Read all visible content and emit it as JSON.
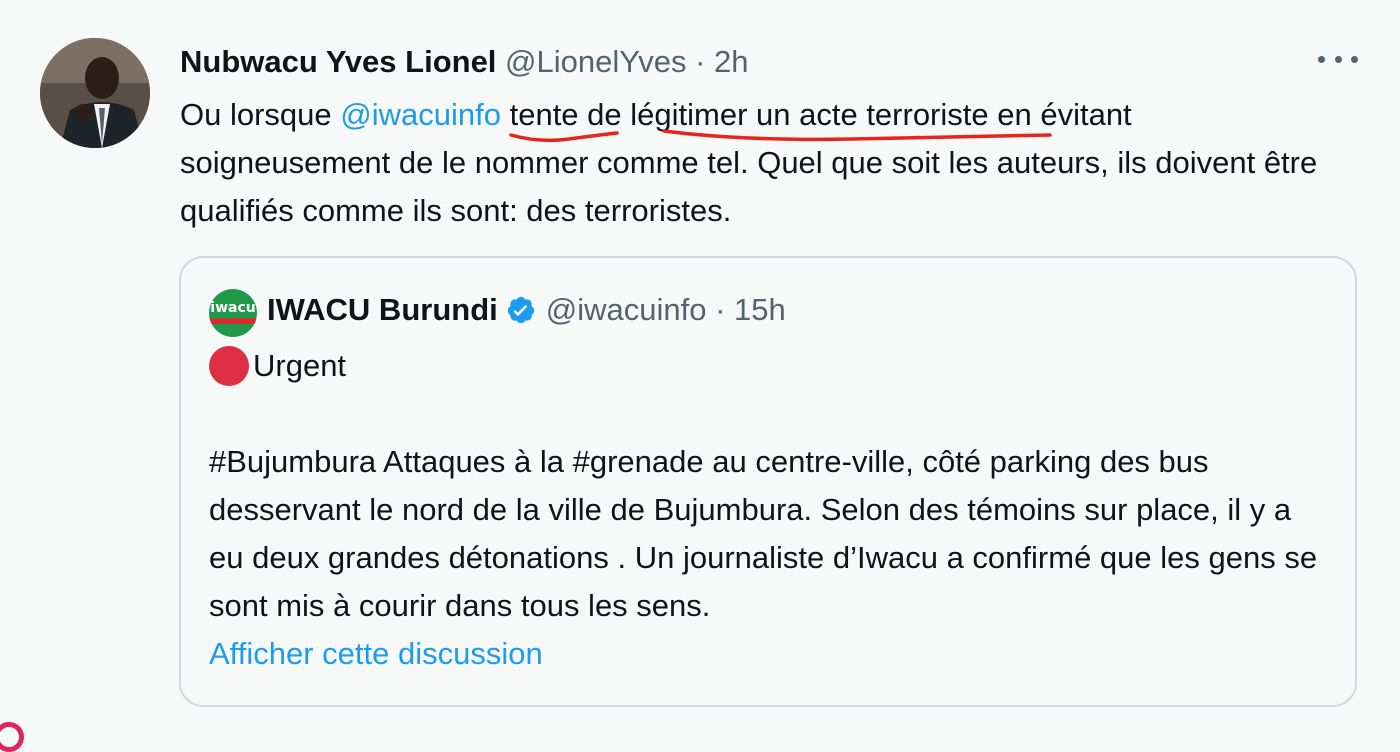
{
  "tweet": {
    "author_name": "Nubwacu Yves Lionel",
    "author_handle": "@LionelYves",
    "separator": "·",
    "time": "2h",
    "text_before": "Ou lorsque ",
    "mention": "@iwacuinfo",
    "text_underlined_1": " tente de",
    "text_mid": " lég",
    "text_underlined_2": "itimer un acte terroriste",
    "text_after": " en évitant soigneusement de le nommer comme tel. Quel que soit les auteurs, ils doivent être qualifiés comme ils sont: des terroristes.",
    "more_icon": "more-horizontal-icon",
    "annotation_color": "#e8231b"
  },
  "quote": {
    "avatar_logo_text": "iwacu",
    "author_name": "IWACU Burundi",
    "verified_icon": "verified-badge-icon",
    "author_handle": "@iwacuinfo",
    "separator": "·",
    "time": "15h",
    "urgent_icon": "red-circle-emoji",
    "urgent_label": "Urgent",
    "body": "#Bujumbura Attaques à la #grenade au centre-ville, côté parking des bus desservant le nord de la ville de Bujumbura. Selon des témoins sur place, il y a eu deux grandes détonations . Un journaliste d’Iwacu a confirmé que les gens se sont mis à courir dans tous les sens.",
    "show_thread": "Afficher cette discussion"
  },
  "colors": {
    "link": "#1d9bf0",
    "text": "#0f1419",
    "secondary": "#536471",
    "background": "#f7f9f9",
    "border": "#cfd9de",
    "verified": "#1d9bf0"
  }
}
